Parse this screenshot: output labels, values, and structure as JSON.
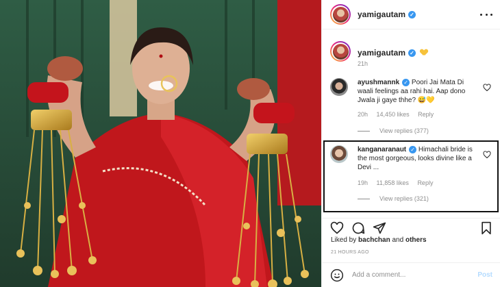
{
  "post": {
    "author": "yamigautam",
    "more_icon": "more-horizontal-icon"
  },
  "caption": {
    "author": "yamigautam",
    "emoji": "yellow-heart",
    "time": "21h"
  },
  "comments": [
    {
      "user": "ayushmannk",
      "verified": true,
      "text": "Poori Jai Mata Di waali feelings aa rahi hai. Aap dono Jwala ji gaye thhe? 😅💛",
      "time": "20h",
      "likes": "14,450 likes",
      "reply": "Reply",
      "view_replies": "View replies (377)"
    },
    {
      "user": "kanganaranaut",
      "verified": true,
      "text": "Himachali bride is the most gorgeous, looks divine like a Devi ...",
      "time": "19h",
      "likes": "11,858 likes",
      "reply": "Reply",
      "view_replies": "View replies (321)"
    }
  ],
  "actions": {
    "icons": [
      "heart-icon",
      "comment-icon",
      "share-icon",
      "bookmark-icon"
    ]
  },
  "likes": {
    "prefix": "Liked by",
    "user": "bachchan",
    "and": "and",
    "others": "others"
  },
  "timestamp": "21 HOURS AGO",
  "add_comment": {
    "placeholder": "Add a comment...",
    "post_label": "Post"
  },
  "colors": {
    "verified_blue": "#3897f0",
    "post_disabled": "#b3dbff",
    "saree_red": "#c0171c",
    "highlight_border": "#111111"
  }
}
